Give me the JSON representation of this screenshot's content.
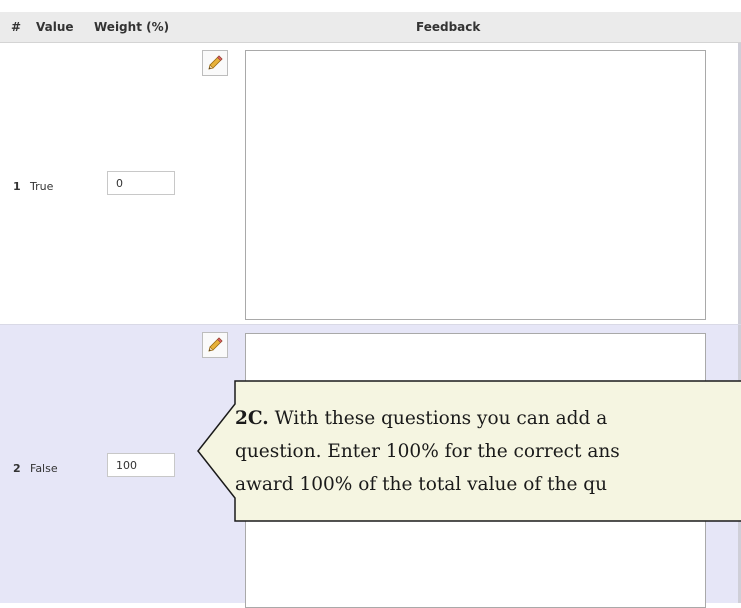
{
  "header": {
    "col_num": "#",
    "col_value": "Value",
    "col_weight": "Weight (%)",
    "col_feedback": "Feedback"
  },
  "rows": [
    {
      "num": "1",
      "value": "True",
      "weight": "0",
      "feedback": ""
    },
    {
      "num": "2",
      "value": "False",
      "weight": "100",
      "feedback": ""
    }
  ],
  "icons": {
    "edit": "pencil-icon"
  },
  "callout": {
    "label": "2C.",
    "lines": [
      "With these questions you can add a",
      "question. Enter 100% for the correct ans",
      "award 100% of the total value of the qu"
    ]
  },
  "colors": {
    "header_bg": "#ebebeb",
    "row_alt_bg": "#e6e6f7",
    "callout_bg": "#f5f5e1"
  }
}
